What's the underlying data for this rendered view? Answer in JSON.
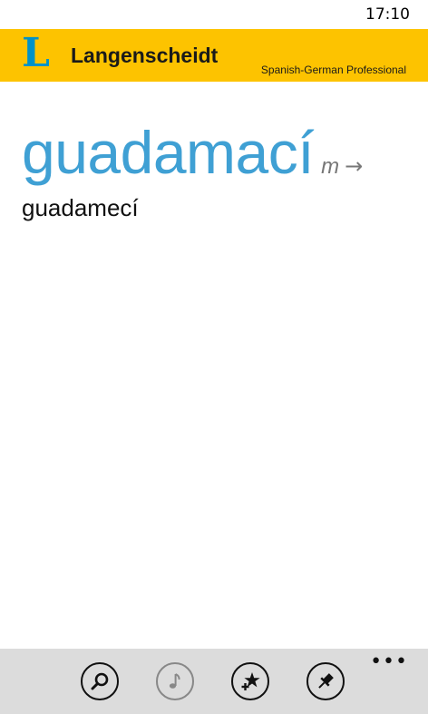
{
  "status_bar": {
    "time": "17:10"
  },
  "header": {
    "logo_letter": "L",
    "brand": "Langenscheidt",
    "dictionary": "Spanish-German Professional",
    "bg_color": "#fdc300",
    "logo_color": "#0092c8"
  },
  "entry": {
    "headword": "guadamací",
    "gender": "m",
    "arrow": "→",
    "reference": "guadamecí",
    "headword_color": "#3fa0d4"
  },
  "app_bar": {
    "buttons": [
      {
        "icon": "search-icon",
        "enabled": true
      },
      {
        "icon": "music-note-icon",
        "enabled": false
      },
      {
        "icon": "add-favorite-icon",
        "enabled": true
      },
      {
        "icon": "pin-icon",
        "enabled": true
      }
    ],
    "more": "•••"
  }
}
